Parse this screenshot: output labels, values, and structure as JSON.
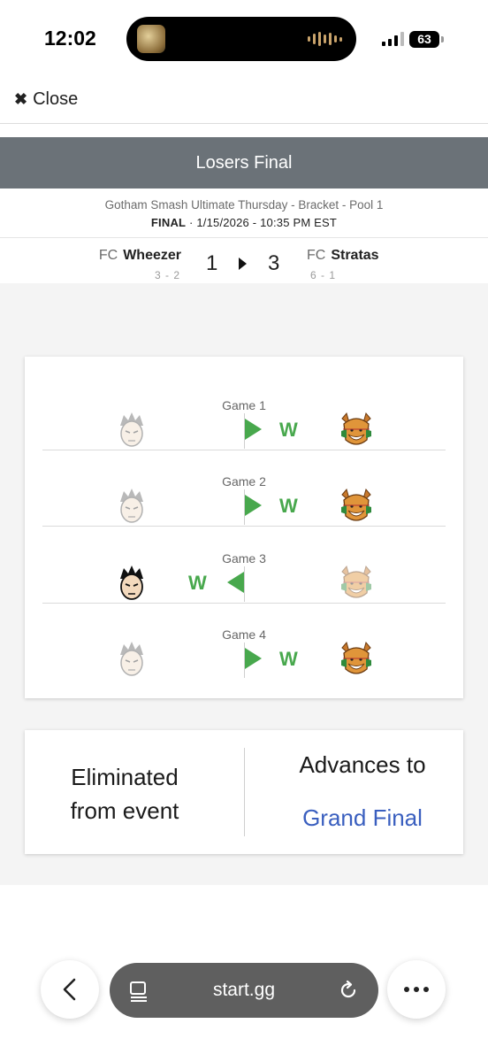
{
  "status_bar": {
    "time": "12:02",
    "battery": "63"
  },
  "nav": {
    "close_label": "Close",
    "close_icon": "close-x-icon"
  },
  "match": {
    "round": "Losers Final",
    "event": "Gotham Smash Ultimate Thursday - Bracket - Pool 1",
    "state": "FINAL",
    "datetime": " · 1/15/2026 - 10:35 PM EST",
    "player_left": {
      "prefix": "FC",
      "name": "Wheezer",
      "record": "3 - 2",
      "score": "1"
    },
    "player_right": {
      "prefix": "FC",
      "name": "Stratas",
      "record": "6 - 1",
      "score": "3"
    }
  },
  "games": [
    {
      "label": "Game 1",
      "winner": "right",
      "win_text": "W",
      "left_char": "kazuya-icon",
      "right_char": "fox-icon"
    },
    {
      "label": "Game 2",
      "winner": "right",
      "win_text": "W",
      "left_char": "kazuya-icon",
      "right_char": "fox-icon"
    },
    {
      "label": "Game 3",
      "winner": "left",
      "win_text": "W",
      "left_char": "kazuya-icon",
      "right_char": "fox-icon"
    },
    {
      "label": "Game 4",
      "winner": "right",
      "win_text": "W",
      "left_char": "kazuya-icon",
      "right_char": "fox-icon"
    }
  ],
  "result": {
    "left_line1": "Eliminated",
    "left_line2": "from event",
    "right_title": "Advances to",
    "right_link": "Grand Final"
  },
  "browser": {
    "url": "start.gg"
  },
  "colors": {
    "header_band": "#6b7278",
    "win_green": "#48a84d",
    "link_blue": "#3a5fbf"
  }
}
